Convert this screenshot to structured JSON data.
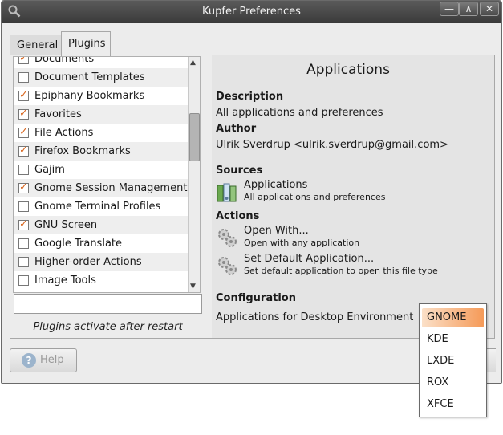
{
  "window": {
    "title": "Kupfer Preferences",
    "title_icon": "search-icon",
    "controls": {
      "minimize": "—",
      "maximize": "∧",
      "close": "✕"
    }
  },
  "tabs": [
    {
      "label": "General",
      "active": false
    },
    {
      "label": "Plugins",
      "active": true
    }
  ],
  "plugins": [
    {
      "label": "Documents",
      "checked": true
    },
    {
      "label": "Document Templates",
      "checked": false
    },
    {
      "label": "Epiphany Bookmarks",
      "checked": true
    },
    {
      "label": "Favorites",
      "checked": true
    },
    {
      "label": "File Actions",
      "checked": true
    },
    {
      "label": "Firefox Bookmarks",
      "checked": true
    },
    {
      "label": "Gajim",
      "checked": false
    },
    {
      "label": "Gnome Session Management",
      "checked": true
    },
    {
      "label": "Gnome Terminal Profiles",
      "checked": false
    },
    {
      "label": "GNU Screen",
      "checked": true
    },
    {
      "label": "Google Translate",
      "checked": false
    },
    {
      "label": "Higher-order Actions",
      "checked": false
    },
    {
      "label": "Image Tools",
      "checked": false
    }
  ],
  "filter": {
    "value": ""
  },
  "restart_note": "Plugins activate after restart",
  "details": {
    "title": "Applications",
    "description_heading": "Description",
    "description": "All applications and preferences",
    "author_heading": "Author",
    "author": "Ulrik Sverdrup <ulrik.sverdrup@gmail.com>",
    "sources_heading": "Sources",
    "sources": [
      {
        "name": "Applications",
        "desc": "All applications and preferences",
        "icon": "applications-icon"
      }
    ],
    "actions_heading": "Actions",
    "actions": [
      {
        "name": "Open With...",
        "desc": "Open with any application",
        "icon": "gears-icon"
      },
      {
        "name": "Set Default Application...",
        "desc": "Set default application to open this file type",
        "icon": "gears-icon"
      }
    ],
    "config_heading": "Configuration",
    "config_label": "Applications for Desktop Environment"
  },
  "dropdown": {
    "options": [
      "GNOME",
      "KDE",
      "LXDE",
      "ROX",
      "XFCE"
    ],
    "selected": "GNOME"
  },
  "help_button": {
    "label": "Help",
    "icon": "help-icon"
  },
  "colors": {
    "check": "#d8631a",
    "selection": "#f59a58",
    "titlebar": "#3a3a3a"
  }
}
